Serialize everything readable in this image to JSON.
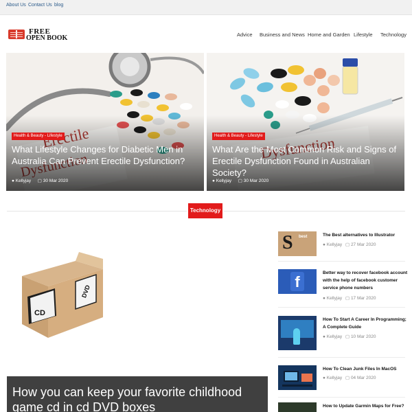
{
  "topbar": {
    "links": [
      "About Us",
      "Contact Us",
      "blog"
    ]
  },
  "logo": {
    "line1": "FREE",
    "line2": "OPEN BOOK"
  },
  "nav": {
    "items": [
      "Advice",
      "Business and News",
      "Home and Garden",
      "Lifestyle",
      "Technology"
    ]
  },
  "hero": [
    {
      "tag": "Health & Beauty - Lifestyle",
      "title": "What Lifestyle Changes for Diabetic Men in Australia Can Prevent Erectile Dysfunction?",
      "author": "Kellyjay",
      "date": "30 Mar 2020",
      "image_text": "Erectile Dysfunction"
    },
    {
      "tag": "Health & Beauty - Lifestyle",
      "title": "What Are the Most Common Risk and Signs of Erectile Dysfunction Found in Australian Society?",
      "author": "Kellyjay",
      "date": "30 Mar 2020",
      "image_text": "Dysfunction"
    }
  ],
  "section": {
    "label": "Technology"
  },
  "feature": {
    "title": "How you can keep your favorite childhood game cd in cd DVD boxes",
    "box_labels": [
      "CD",
      "DVD"
    ]
  },
  "sidebar": [
    {
      "title": "The Best alternatives to Illustrator",
      "author": "Kellyjay",
      "date": "27 Mar 2020",
      "thumb_text": "best"
    },
    {
      "title": "Better way to recover facebook account with the help of facebook customer service phone numbers",
      "author": "Kellyjay",
      "date": "17 Mar 2020",
      "thumb_text": "f"
    },
    {
      "title": "How To Start A Career In Programming; A Complete Guide",
      "author": "Kellyjay",
      "date": "10 Mar 2020"
    },
    {
      "title": "How To Clean Junk Files In MacOS",
      "author": "Kellyjay",
      "date": "04 Mar 2020"
    },
    {
      "title": "How to Update Garmin Maps for Free?",
      "author": "",
      "date": ""
    }
  ],
  "icons": {
    "author": "user-icon",
    "date": "calendar-icon"
  },
  "colors": {
    "accent": "#e21b1b",
    "link": "#2b5a8a"
  }
}
